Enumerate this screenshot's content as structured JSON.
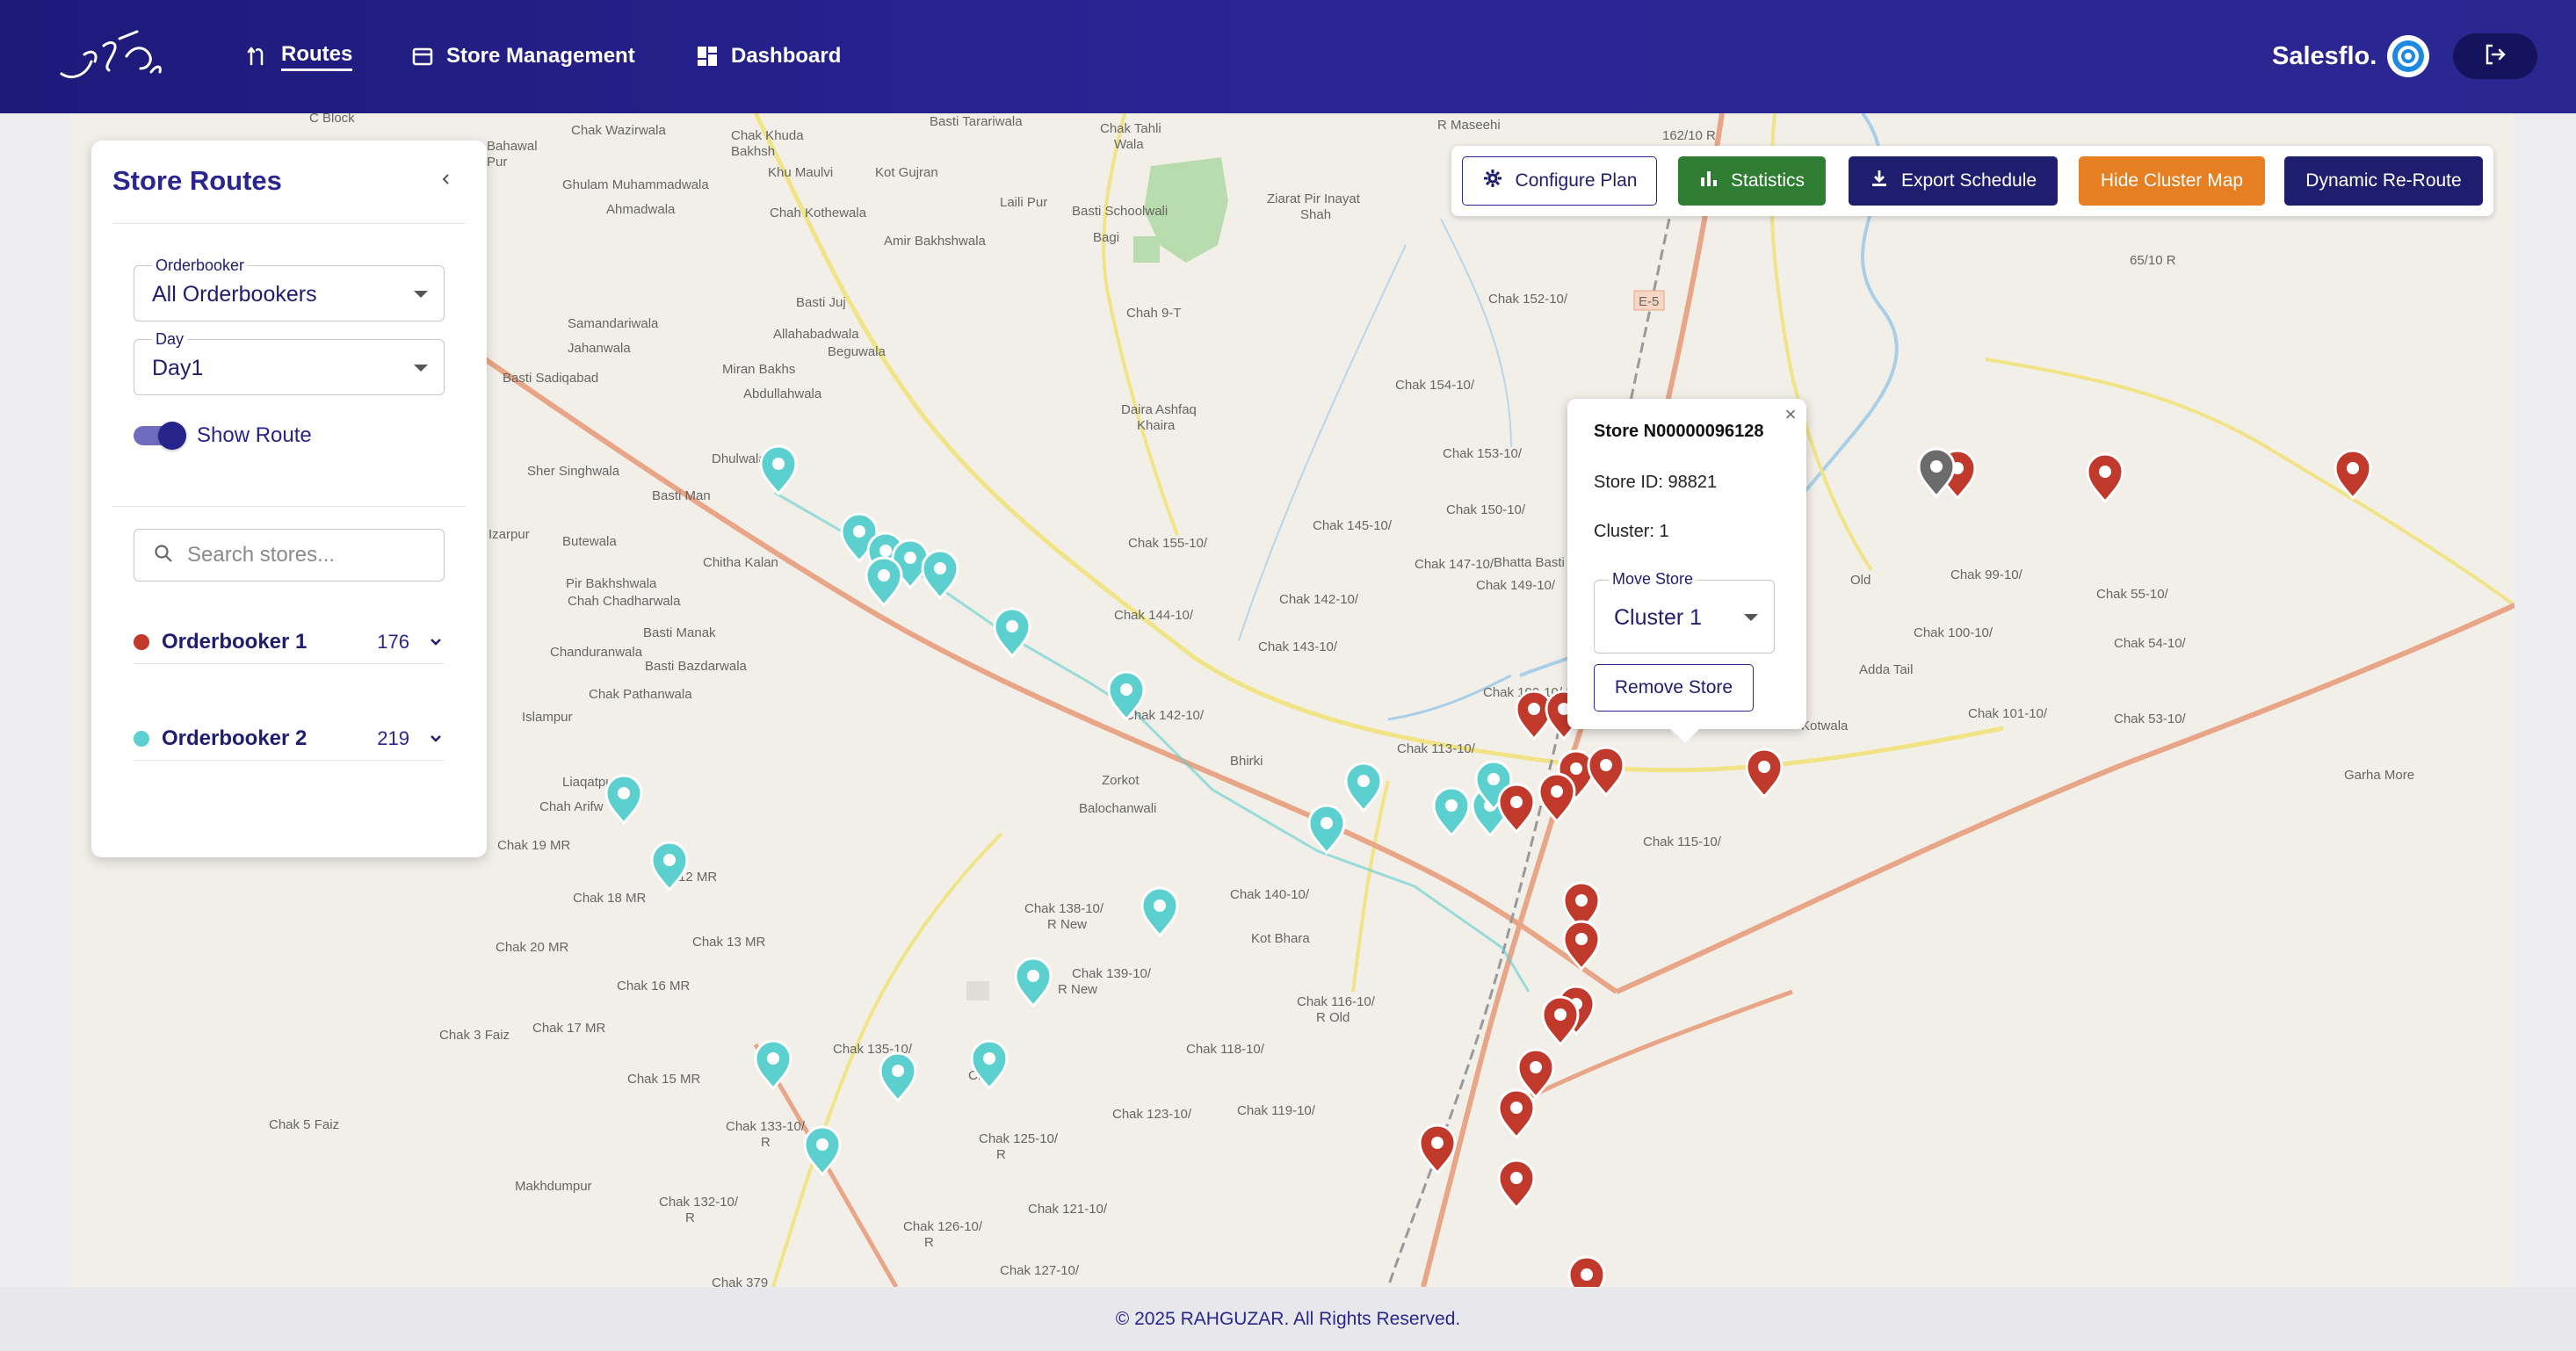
{
  "header": {
    "nav": [
      {
        "label": "Routes",
        "icon": "route-icon",
        "active": true
      },
      {
        "label": "Store Management",
        "icon": "store-icon",
        "active": false
      },
      {
        "label": "Dashboard",
        "icon": "dashboard-icon",
        "active": false
      }
    ],
    "brand_label": "Salesflo.",
    "logout_icon": "logout-icon"
  },
  "sidebar": {
    "title": "Store Routes",
    "orderbooker_filter": {
      "label": "Orderbooker",
      "value": "All Orderbookers"
    },
    "day_filter": {
      "label": "Day",
      "value": "Day1"
    },
    "show_route": {
      "label": "Show Route",
      "on": true
    },
    "search": {
      "placeholder": "Search stores..."
    },
    "orderbookers": [
      {
        "name": "Orderbooker 1",
        "count": "176",
        "color": "#c0392b"
      },
      {
        "name": "Orderbooker 2",
        "count": "219",
        "color": "#5ccfcf"
      }
    ]
  },
  "toolbar": {
    "configure_plan": "Configure Plan",
    "statistics": "Statistics",
    "export_schedule": "Export Schedule",
    "hide_cluster_map": "Hide Cluster Map",
    "dynamic_reroute": "Dynamic Re-Route"
  },
  "popup": {
    "title": "Store N00000096128",
    "store_id": "Store ID: 98821",
    "cluster": "Cluster: 1",
    "move_store_label": "Move Store",
    "move_store_value": "Cluster 1",
    "remove_label": "Remove Store",
    "close": "×"
  },
  "map_labels": [
    "C Block",
    "Chak Wazirwala",
    "Chak Khuda Bakhsh",
    "Basti Tarariwala",
    "Chak Tahli Wala",
    "R Maseehi",
    "162/10 R",
    "Khu Maulvi",
    "Kot Gujran",
    "Bahawal",
    "Ghulam Muhammadwala",
    "Ahmadwala",
    "Chah Kothewala",
    "Laili Pur",
    "Basti Schoolwali",
    "Ziarat Pir Inayat Shah",
    "Amir Bakhshwala",
    "Bagi",
    "65/10 R",
    "Basti Juj",
    "Chah 9-T",
    "Chak 152-10/",
    "Samandariwala",
    "Allahabadwala",
    "Beguwala",
    "Jahanwala",
    "Basti Sadiqabad",
    "Miran Bakhs",
    "Abdullahwala",
    "Chak 154-10/",
    "Daira Ashfaq Khaira",
    "Chak 153-10/",
    "Dhulwala",
    "Sher Singhwala",
    "Basti Man",
    "Chak 150-10/",
    "Chak 145-10/",
    "Butewala",
    "Chak 155-10/",
    "Chitha Kalan",
    "Chak 147-10/",
    "Bhatta Basti",
    "Chak 149-10/",
    "Pir Bakhshwala",
    "Chah Chadharwala",
    "Chak 142-10/",
    "Chak 99-10/",
    "Chak 55-10/",
    "Basti Manak",
    "Chak 144-10/",
    "Chak 143-10/",
    "Chanduranwala",
    "Basti Bazdarwala",
    "Chak 100-10/",
    "Chak 54-10/",
    "Adda Tail",
    "Chak Pathanwala",
    "Chak 109-10/",
    "Chak 101-10/",
    "Chak 53-10/",
    "Islampur",
    "Chak 142-10/",
    "Kotwala",
    "Bhirki",
    "Liaqatpur",
    "Zorkot",
    "Chak 113-10/",
    "Garha More",
    "Chah Arifw",
    "Balochanwali",
    "Chak 19 MR",
    "Chak 115-10/",
    "12 MR",
    "Chak 18 MR",
    "Chak 140-10/",
    "Chak 138-10/ R New",
    "Chak 13 MR",
    "Kot Bhara",
    "Chak 20 MR",
    "Chak 139-10/ R New",
    "Chak 16 MR",
    "Chak 116-10/ R Old",
    "Chak 17 MR",
    "Chak 118-10/",
    "Chak 3 Faiz",
    "Chak 135-10/",
    "Chak 15 MR",
    "Chak 5 Faiz",
    "Chak 133-10/",
    "Chak 119-10/",
    "Chak 123-10/",
    "Chak 125-10/",
    "Makhdumpur",
    "Chak 132-10/",
    "Chak 121-10/",
    "Chak 126-10/",
    "Chak 127-10/",
    "Chak 379",
    "E-5"
  ],
  "footer": {
    "text": "© 2025 RAHGUZAR. All Rights Reserved."
  },
  "colors": {
    "header_bg": "#2a2596",
    "primary": "#1f1d6d",
    "statistics": "#2e7d32",
    "hide_cluster": "#e67e22",
    "orderbooker_1": "#c0392b",
    "orderbooker_2": "#5ccfcf"
  }
}
